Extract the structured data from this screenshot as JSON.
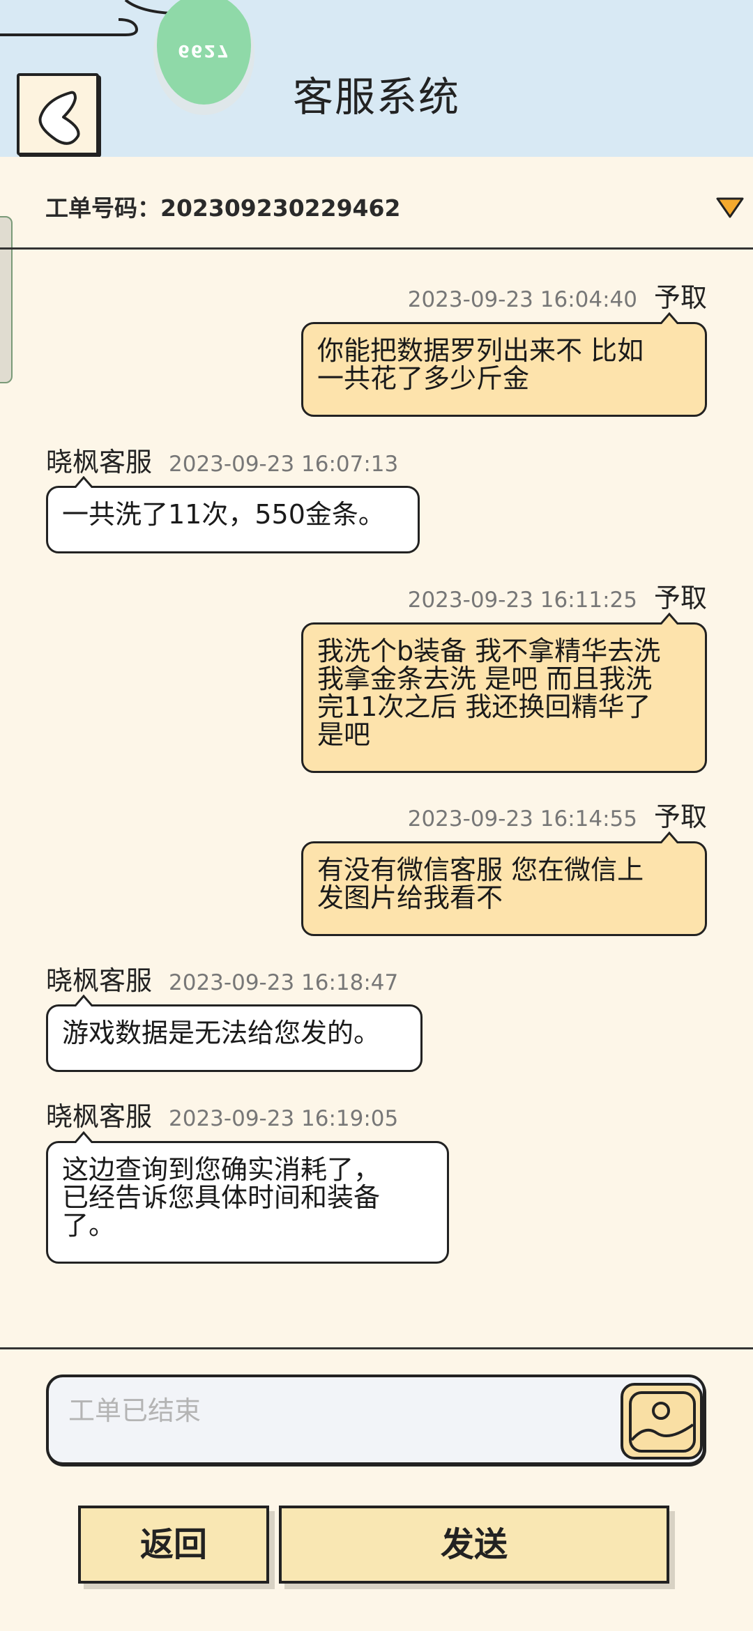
{
  "header": {
    "title": "客服系统",
    "avatar_text": "6627"
  },
  "ticket": {
    "label": "工单号码：",
    "number": "202309230229462"
  },
  "messages": [
    {
      "side": "me",
      "name": "予取",
      "time": "2023-09-23 16:04:40",
      "lines": [
        "你能把数据罗列出来不 比如",
        "一共花了多少斤金"
      ]
    },
    {
      "side": "cs",
      "name": "晓枫客服",
      "time": "2023-09-23 16:07:13",
      "lines": [
        "一共洗了11次，550金条。"
      ]
    },
    {
      "side": "me",
      "name": "予取",
      "time": "2023-09-23 16:11:25",
      "lines": [
        "我洗个b装备 我不拿精华去洗",
        "我拿金条去洗 是吧 而且我洗",
        "完11次之后 我还换回精华了",
        "是吧"
      ]
    },
    {
      "side": "me",
      "name": "予取",
      "time": "2023-09-23 16:14:55",
      "lines": [
        "有没有微信客服 您在微信上",
        "发图片给我看不"
      ]
    },
    {
      "side": "cs",
      "name": "晓枫客服",
      "time": "2023-09-23 16:18:47",
      "lines": [
        "游戏数据是无法给您发的。"
      ]
    },
    {
      "side": "cs",
      "name": "晓枫客服",
      "time": "2023-09-23 16:19:05",
      "lines": [
        "这边查询到您确实消耗了，",
        "已经告诉您具体时间和装备",
        "了。"
      ]
    }
  ],
  "composer": {
    "placeholder": "工单已结束"
  },
  "buttons": {
    "back_label": "返回",
    "send_label": "发送"
  },
  "icons": {
    "back": "chevron-left-icon",
    "dropdown": "triangle-down-icon",
    "image": "image-icon"
  },
  "colors": {
    "header_bg": "#d8e9f4",
    "page_bg": "#fdf6e8",
    "my_bubble": "#fde3ac",
    "cs_bubble": "#ffffff",
    "button_bg": "#f9e7b3",
    "dropdown_fill": "#f4a92e"
  }
}
